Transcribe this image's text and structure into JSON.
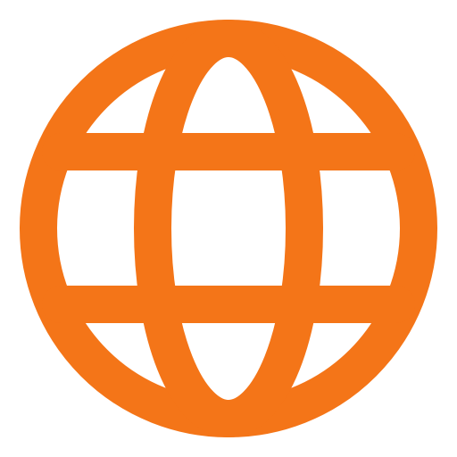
{
  "icon": {
    "name": "globe-icon",
    "color": "#F47518"
  }
}
